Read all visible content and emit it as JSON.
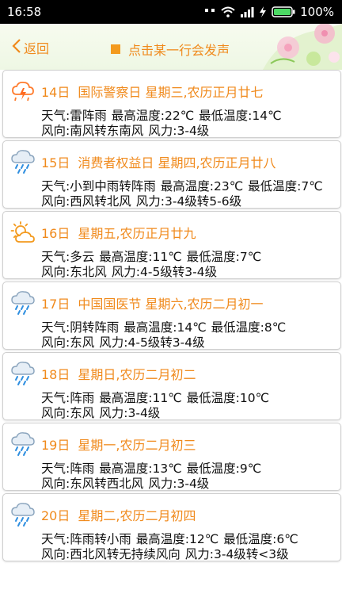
{
  "status_bar": {
    "time": "16:58",
    "battery_percent": "100%",
    "icons": [
      "sim-signal-icon",
      "wifi-icon",
      "cell-signal-icon",
      "charging-icon",
      "battery-icon"
    ]
  },
  "header": {
    "back_label": "返回",
    "hint_text": "点击某一行会发声",
    "accent_color": "#f08a1c"
  },
  "days": [
    {
      "day": "14日",
      "desc": "国际警察日 星期三,农历正月廿七",
      "icon": "thunderstorm-icon",
      "weather_label": "天气:",
      "weather": "雷阵雨",
      "high_label": "最高温度:",
      "high": "22℃",
      "low_label": "最低温度:",
      "low": "14℃",
      "wind_dir_label": "风向:",
      "wind_dir": "南风转东南风",
      "wind_force_label": "风力:",
      "wind_force": "3-4级"
    },
    {
      "day": "15日",
      "desc": "消费者权益日 星期四,农历正月廿八",
      "icon": "rain-cloud-icon",
      "weather_label": "天气:",
      "weather": "小到中雨转阵雨",
      "high_label": "最高温度:",
      "high": "23℃",
      "low_label": "最低温度:",
      "low": "7℃",
      "wind_dir_label": "风向:",
      "wind_dir": "西风转北风",
      "wind_force_label": "风力:",
      "wind_force": "3-4级转5-6级"
    },
    {
      "day": "16日",
      "desc": "星期五,农历正月廿九",
      "icon": "partly-cloudy-icon",
      "weather_label": "天气:",
      "weather": "多云",
      "high_label": "最高温度:",
      "high": "11℃",
      "low_label": "最低温度:",
      "low": "7℃",
      "wind_dir_label": "风向:",
      "wind_dir": "东北风",
      "wind_force_label": "风力:",
      "wind_force": "4-5级转3-4级"
    },
    {
      "day": "17日",
      "desc": "中国国医节 星期六,农历二月初一",
      "icon": "rain-cloud-icon",
      "weather_label": "天气:",
      "weather": "阴转阵雨",
      "high_label": "最高温度:",
      "high": "14℃",
      "low_label": "最低温度:",
      "low": "8℃",
      "wind_dir_label": "风向:",
      "wind_dir": "东风",
      "wind_force_label": "风力:",
      "wind_force": "4-5级转3-4级"
    },
    {
      "day": "18日",
      "desc": "星期日,农历二月初二",
      "icon": "rain-cloud-icon",
      "weather_label": "天气:",
      "weather": "阵雨",
      "high_label": "最高温度:",
      "high": "11℃",
      "low_label": "最低温度:",
      "low": "10℃",
      "wind_dir_label": "风向:",
      "wind_dir": "东风",
      "wind_force_label": "风力:",
      "wind_force": "3-4级"
    },
    {
      "day": "19日",
      "desc": "星期一,农历二月初三",
      "icon": "rain-cloud-icon",
      "weather_label": "天气:",
      "weather": "阵雨",
      "high_label": "最高温度:",
      "high": "13℃",
      "low_label": "最低温度:",
      "low": "9℃",
      "wind_dir_label": "风向:",
      "wind_dir": "东风转西北风",
      "wind_force_label": "风力:",
      "wind_force": "3-4级"
    },
    {
      "day": "20日",
      "desc": "星期二,农历二月初四",
      "icon": "rain-cloud-icon",
      "weather_label": "天气:",
      "weather": "阵雨转小雨",
      "high_label": "最高温度:",
      "high": "12℃",
      "low_label": "最低温度:",
      "low": "6℃",
      "wind_dir_label": "风向:",
      "wind_dir": "西北风转无持续风向",
      "wind_force_label": "风力:",
      "wind_force": "3-4级转<3级"
    }
  ]
}
